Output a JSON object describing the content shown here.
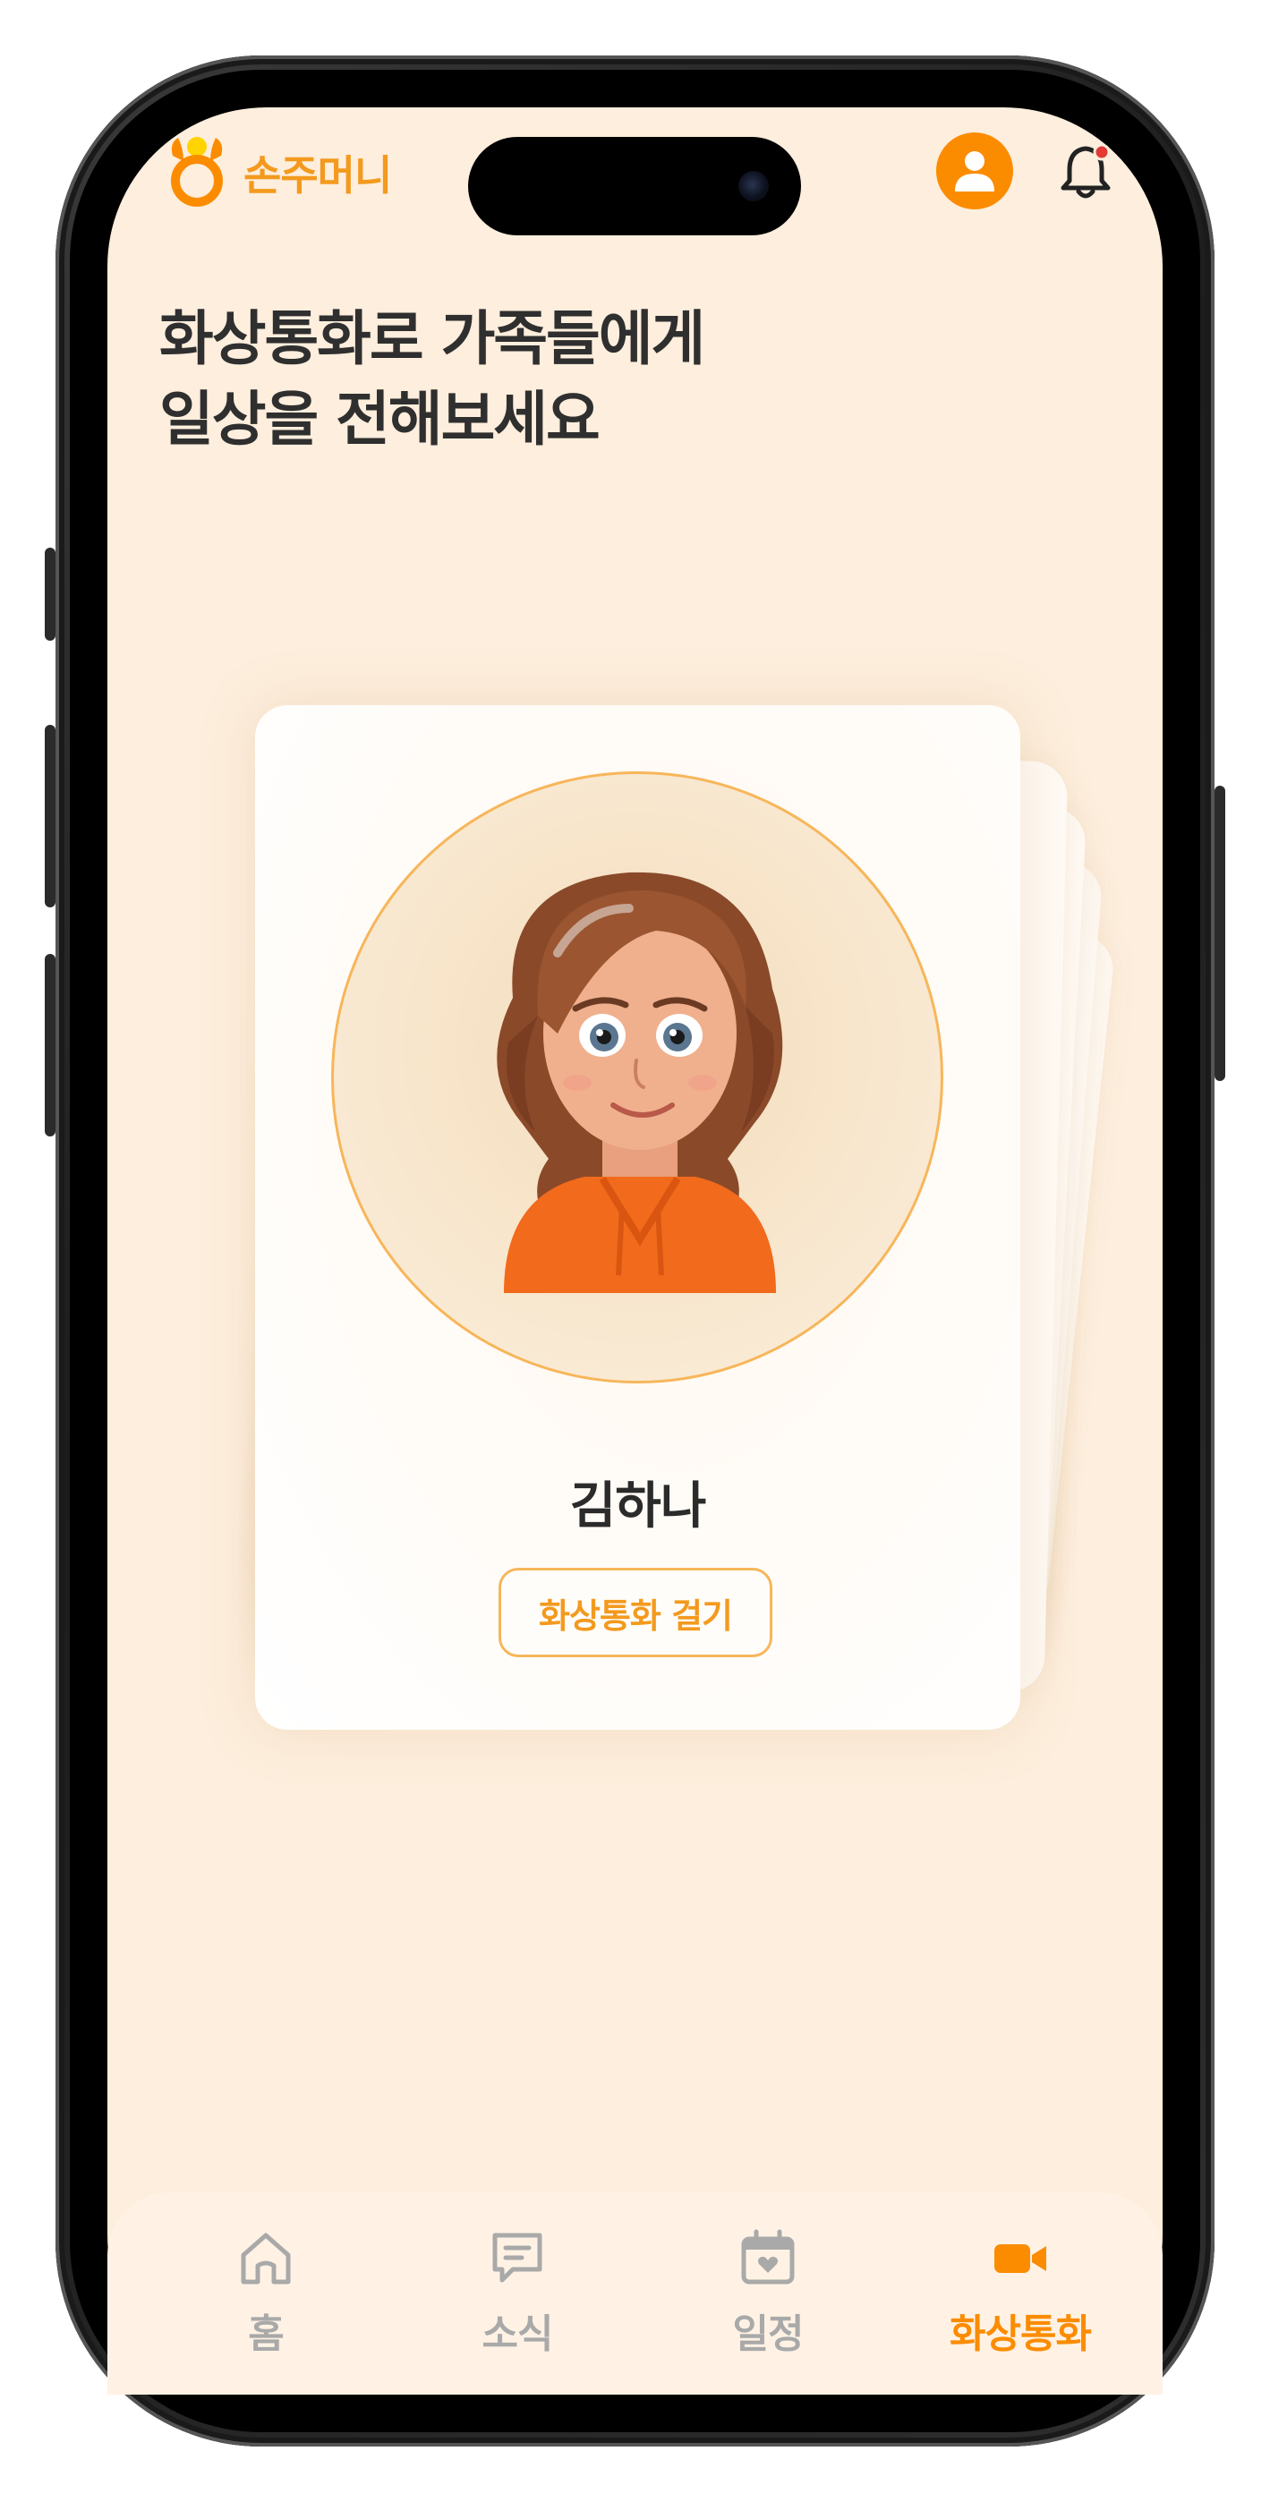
{
  "app": {
    "brand_name": "손주머니",
    "accent_color": "#fb8c00"
  },
  "header": {
    "profile_icon": "person-icon",
    "notification_icon": "bell-icon",
    "notification_badge_color": "#e53935"
  },
  "main": {
    "headline_line1": "화상통화로 가족들에게",
    "headline_line2": "일상을 전해보세요",
    "contact": {
      "name": "김하나",
      "call_button_label": "화상통화 걸기",
      "avatar": "cartoon-woman-orange-hoodie"
    }
  },
  "tabbar": {
    "tabs": [
      {
        "label": "홈",
        "icon": "home-icon",
        "active": false
      },
      {
        "label": "소식",
        "icon": "message-icon",
        "active": false
      },
      {
        "label": "일정",
        "icon": "calendar-icon",
        "active": false
      },
      {
        "label": "화상통화",
        "icon": "video-camera-icon",
        "active": true
      }
    ]
  }
}
